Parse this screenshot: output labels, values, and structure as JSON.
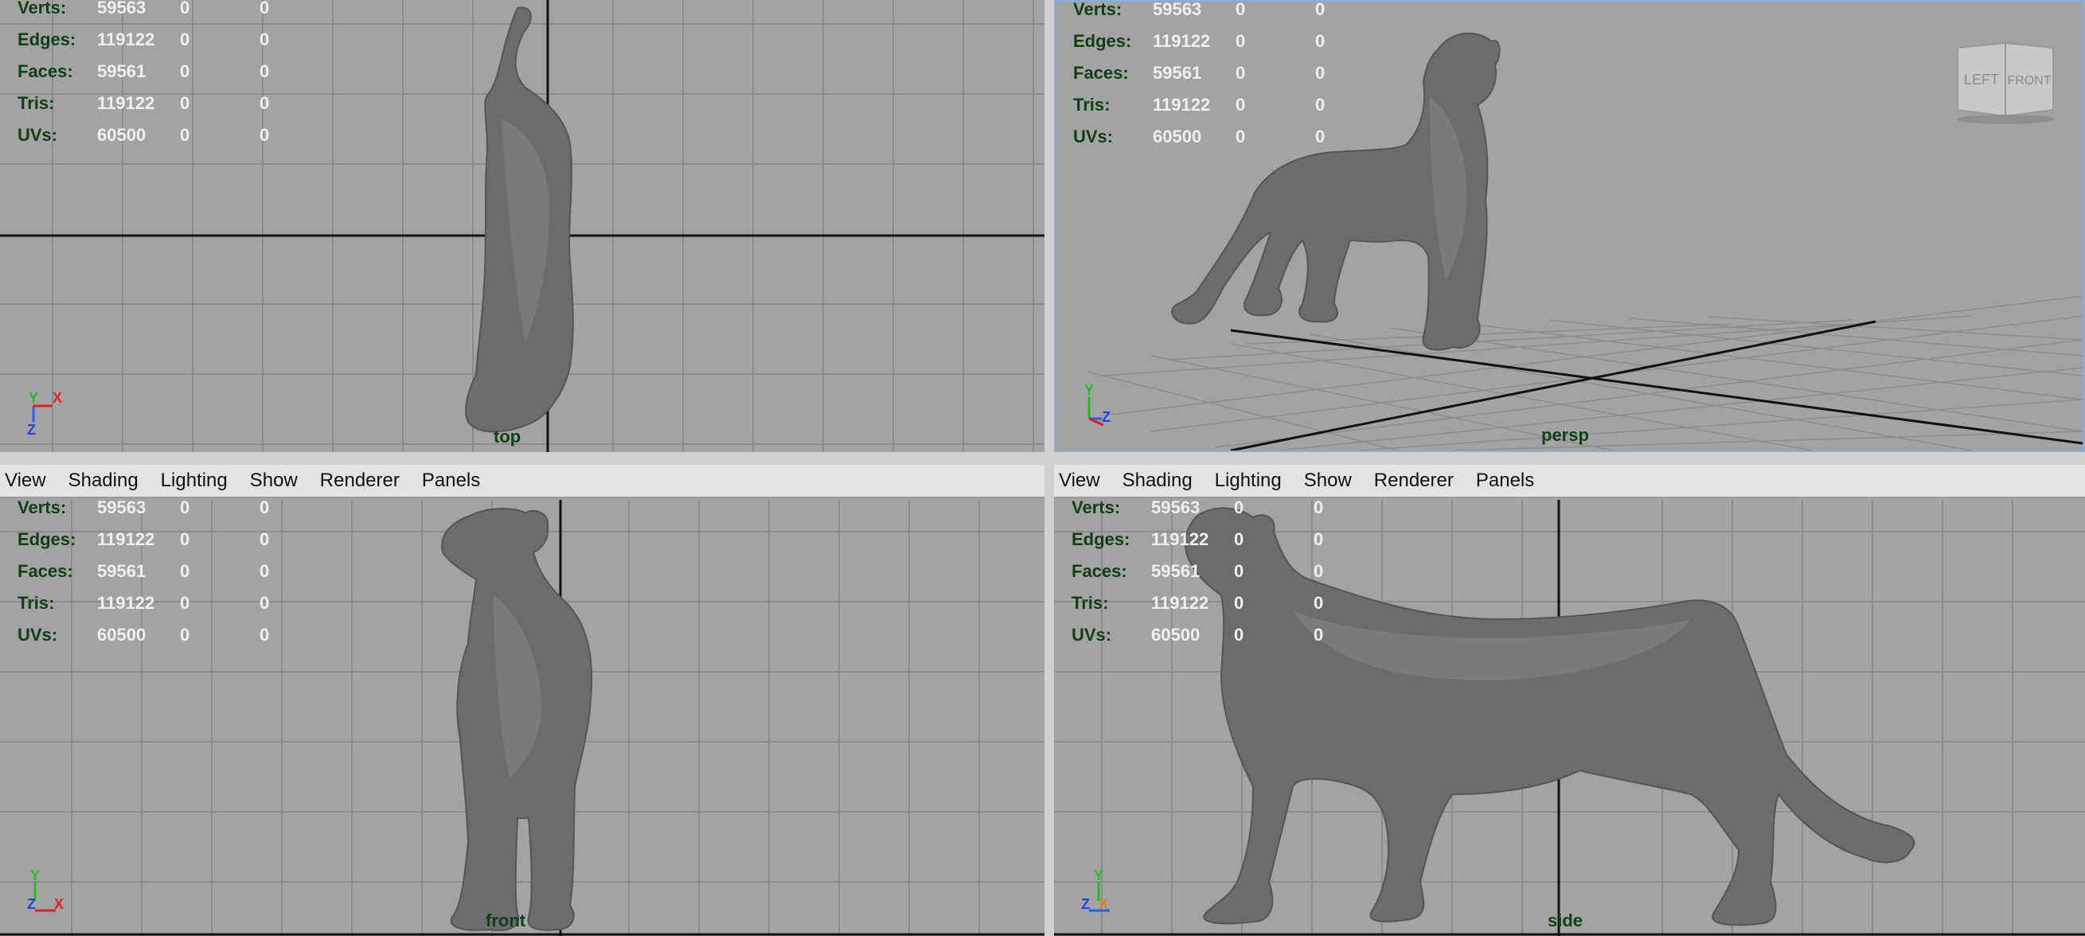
{
  "menu": {
    "view": "View",
    "shading": "Shading",
    "lighting": "Lighting",
    "show": "Show",
    "renderer": "Renderer",
    "panels": "Panels"
  },
  "stats": {
    "verts": {
      "label": "Verts:",
      "v1": "59563",
      "v2": "0",
      "v3": "0"
    },
    "edges": {
      "label": "Edges:",
      "v1": "119122",
      "v2": "0",
      "v3": "0"
    },
    "faces": {
      "label": "Faces:",
      "v1": "59561",
      "v2": "0",
      "v3": "0"
    },
    "tris": {
      "label": "Tris:",
      "v1": "119122",
      "v2": "0",
      "v3": "0"
    },
    "uvs": {
      "label": "UVs:",
      "v1": "60500",
      "v2": "0",
      "v3": "0"
    }
  },
  "viewports": {
    "top": {
      "label": "top"
    },
    "persp": {
      "label": "persp"
    },
    "front": {
      "label": "front"
    },
    "side": {
      "label": "side"
    }
  },
  "viewcube": {
    "left": "LEFT",
    "front": "FRONT"
  },
  "colors": {
    "viewport_bg": "#a3a3a3",
    "grid_line": "#8a8a8a",
    "axis_line": "#1a1a1a",
    "hud_label": "#0f3f12",
    "active_border": "#7fb0ea",
    "model": "#6e6e6e"
  }
}
